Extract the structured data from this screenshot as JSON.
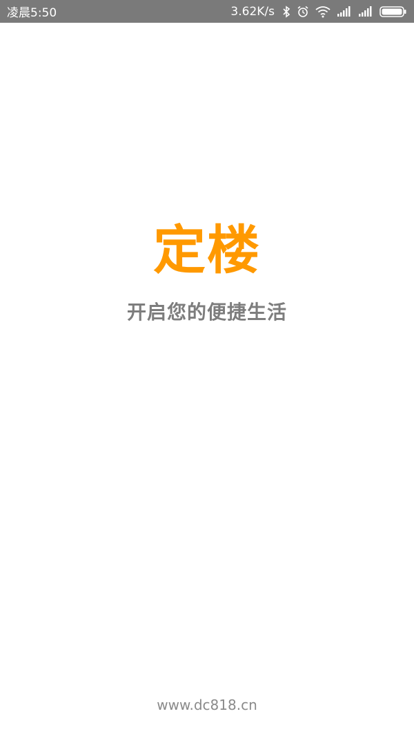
{
  "status_bar": {
    "time": "凌晨5:50",
    "net_speed": "3.62K/s",
    "icons": [
      "bluetooth-icon",
      "alarm-icon",
      "wifi-icon",
      "signal-icon",
      "signal-icon",
      "battery-icon"
    ]
  },
  "splash": {
    "logo_text": "定楼",
    "tagline": "开启您的便捷生活",
    "footer_url": "www.dc818.cn"
  },
  "colors": {
    "brand": "#ff9900",
    "tagline": "#7d7d7d",
    "status_bar_bg": "#7a7a7a"
  }
}
